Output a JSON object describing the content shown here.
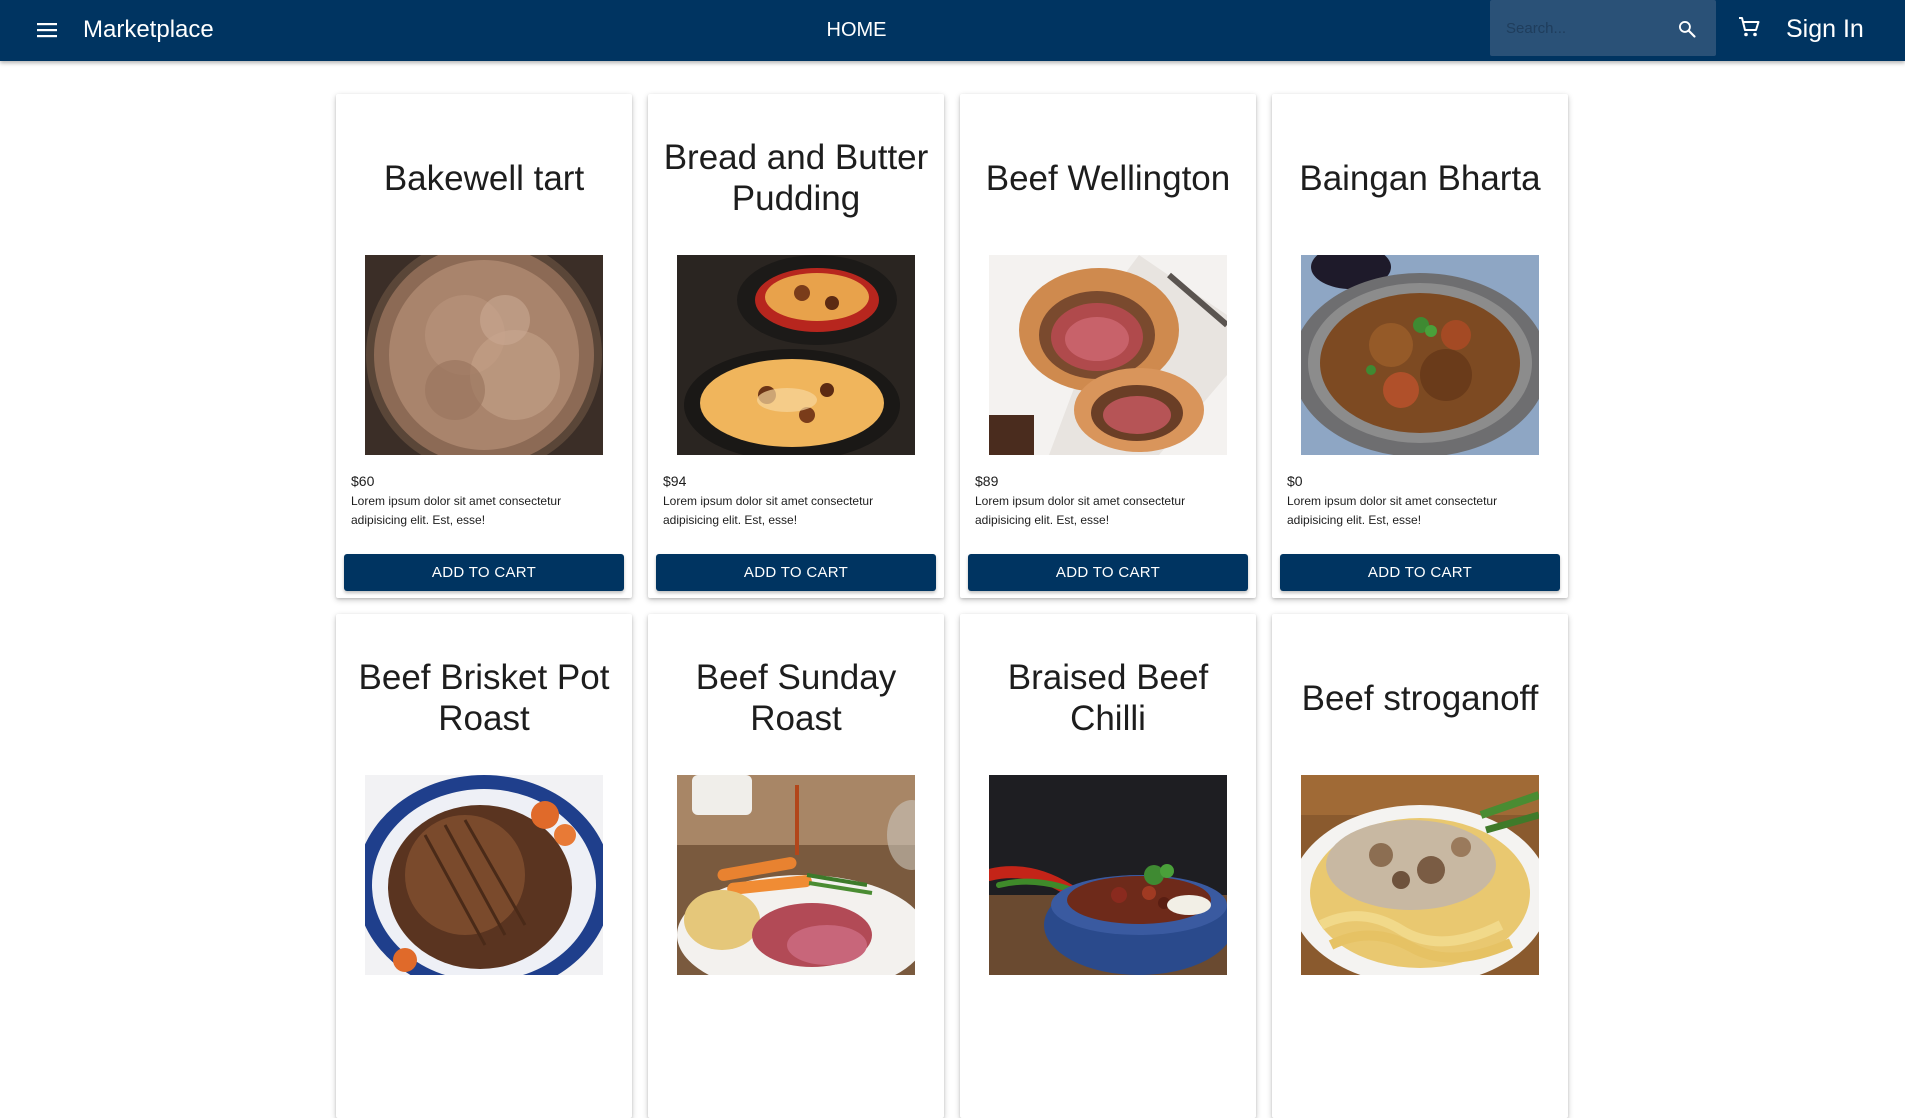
{
  "appbar": {
    "brand": "Marketplace",
    "home_label": "HOME",
    "search_placeholder": "Search...",
    "sign_in_label": "Sign In",
    "menu_icon": "menu-icon",
    "search_icon": "search-icon",
    "cart_icon": "cart-icon"
  },
  "colors": {
    "primary": "#003461",
    "search_bg": "#2a5177",
    "card_bg": "#ffffff",
    "text": "#1d1d1d"
  },
  "products": [
    {
      "title": "Bakewell tart",
      "price": "$60",
      "description": "Lorem ipsum dolor sit amet consectetur adipisicing elit. Est, esse!",
      "button": "ADD TO CART"
    },
    {
      "title": "Bread and Butter Pudding",
      "price": "$94",
      "description": "Lorem ipsum dolor sit amet consectetur adipisicing elit. Est, esse!",
      "button": "ADD TO CART"
    },
    {
      "title": "Beef Wellington",
      "price": "$89",
      "description": "Lorem ipsum dolor sit amet consectetur adipisicing elit. Est, esse!",
      "button": "ADD TO CART"
    },
    {
      "title": "Baingan Bharta",
      "price": "$0",
      "description": "Lorem ipsum dolor sit amet consectetur adipisicing elit. Est, esse!",
      "button": "ADD TO CART"
    },
    {
      "title": "Beef Brisket Pot Roast"
    },
    {
      "title": "Beef Sunday Roast"
    },
    {
      "title": "Braised Beef Chilli"
    },
    {
      "title": "Beef stroganoff"
    }
  ]
}
